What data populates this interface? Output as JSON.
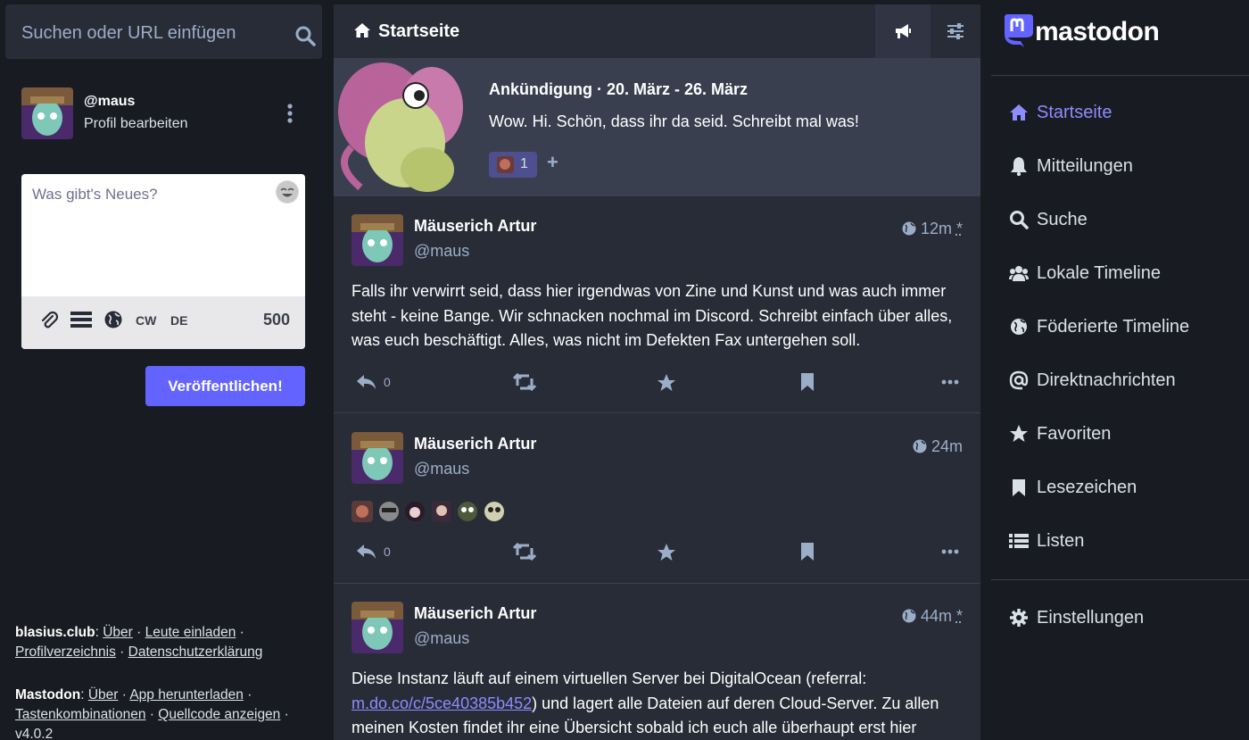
{
  "search": {
    "placeholder": "Suchen oder URL einfügen"
  },
  "profile": {
    "handle": "@maus",
    "edit": "Profil bearbeiten"
  },
  "compose": {
    "placeholder": "Was gibt's Neues?",
    "cw": "CW",
    "lang": "DE",
    "count": "500",
    "publish": "Veröffentlichen!"
  },
  "footer": {
    "server": "blasius.club",
    "server_links": [
      "Über",
      "Leute einladen",
      "Profilverzeichnis",
      "Datenschutzerklärung"
    ],
    "app": "Mastodon",
    "app_links": [
      "Über",
      "App herunterladen",
      "Tastenkombinationen",
      "Quellcode anzeigen"
    ],
    "version": "v4.0.2"
  },
  "column": {
    "title": "Startseite"
  },
  "announcement": {
    "title": "Ankündigung · 20. März - 26. März",
    "text": "Wow. Hi. Schön, dass ihr da seid. Schreibt mal was!",
    "reaction_count": "1"
  },
  "statuses": [
    {
      "name": "Mäuserich Artur",
      "acct": "@maus",
      "time": "12m",
      "edited": "*",
      "content": "Falls ihr verwirrt seid, dass hier irgendwas von Zine und Kunst und was auch immer steht - keine Bange. Wir schnacken nochmal im Discord. Schreibt einfach über alles, was euch beschäftigt. Alles, was nicht im Defekten Fax untergehen soll.",
      "replies": "0"
    },
    {
      "name": "Mäuserich Artur",
      "acct": "@maus",
      "time": "24m",
      "edited": "",
      "content": "",
      "replies": "0"
    },
    {
      "name": "Mäuserich Artur",
      "acct": "@maus",
      "time": "44m",
      "edited": "*",
      "content_pre": "Diese Instanz läuft auf einem virtuellen Server bei DigitalOcean (referral: ",
      "link": "m.do.co/c/5ce40385b452",
      "content_post": ") und lagert alle Dateien auf deren Cloud-Server. Zu allen meinen Kosten findet ihr eine Übersicht sobald ich euch alle überhaupt erst hier",
      "replies": "0"
    }
  ],
  "brand": {
    "name": "mastodon"
  },
  "nav": [
    {
      "label": "Startseite",
      "icon": "home-icon"
    },
    {
      "label": "Mitteilungen",
      "icon": "bell-icon"
    },
    {
      "label": "Suche",
      "icon": "search-icon"
    },
    {
      "label": "Lokale Timeline",
      "icon": "users-icon"
    },
    {
      "label": "Föderierte Timeline",
      "icon": "globe-icon"
    },
    {
      "label": "Direktnachrichten",
      "icon": "at-icon"
    },
    {
      "label": "Favoriten",
      "icon": "star-icon"
    },
    {
      "label": "Lesezeichen",
      "icon": "bookmark-icon"
    },
    {
      "label": "Listen",
      "icon": "list-icon"
    },
    {
      "label": "Einstellungen",
      "icon": "gear-icon"
    }
  ],
  "colors": {
    "accent": "#8c8dff",
    "button": "#6364ff",
    "bg": "#191b22",
    "panel": "#282c37"
  }
}
